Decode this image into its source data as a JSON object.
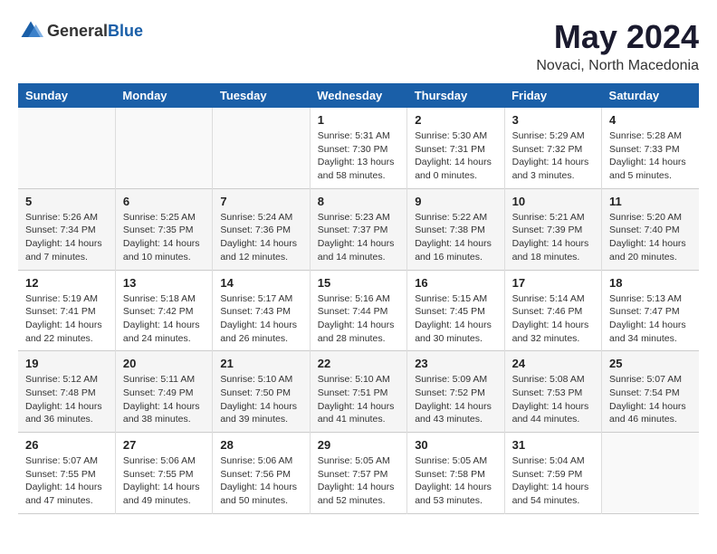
{
  "header": {
    "logo_general": "General",
    "logo_blue": "Blue",
    "title": "May 2024",
    "subtitle": "Novaci, North Macedonia"
  },
  "weekdays": [
    "Sunday",
    "Monday",
    "Tuesday",
    "Wednesday",
    "Thursday",
    "Friday",
    "Saturday"
  ],
  "weeks": [
    [
      {
        "day": "",
        "sunrise": "",
        "sunset": "",
        "daylight": "",
        "empty": true
      },
      {
        "day": "",
        "sunrise": "",
        "sunset": "",
        "daylight": "",
        "empty": true
      },
      {
        "day": "",
        "sunrise": "",
        "sunset": "",
        "daylight": "",
        "empty": true
      },
      {
        "day": "1",
        "sunrise": "Sunrise: 5:31 AM",
        "sunset": "Sunset: 7:30 PM",
        "daylight": "Daylight: 13 hours and 58 minutes.",
        "empty": false
      },
      {
        "day": "2",
        "sunrise": "Sunrise: 5:30 AM",
        "sunset": "Sunset: 7:31 PM",
        "daylight": "Daylight: 14 hours and 0 minutes.",
        "empty": false
      },
      {
        "day": "3",
        "sunrise": "Sunrise: 5:29 AM",
        "sunset": "Sunset: 7:32 PM",
        "daylight": "Daylight: 14 hours and 3 minutes.",
        "empty": false
      },
      {
        "day": "4",
        "sunrise": "Sunrise: 5:28 AM",
        "sunset": "Sunset: 7:33 PM",
        "daylight": "Daylight: 14 hours and 5 minutes.",
        "empty": false
      }
    ],
    [
      {
        "day": "5",
        "sunrise": "Sunrise: 5:26 AM",
        "sunset": "Sunset: 7:34 PM",
        "daylight": "Daylight: 14 hours and 7 minutes.",
        "empty": false
      },
      {
        "day": "6",
        "sunrise": "Sunrise: 5:25 AM",
        "sunset": "Sunset: 7:35 PM",
        "daylight": "Daylight: 14 hours and 10 minutes.",
        "empty": false
      },
      {
        "day": "7",
        "sunrise": "Sunrise: 5:24 AM",
        "sunset": "Sunset: 7:36 PM",
        "daylight": "Daylight: 14 hours and 12 minutes.",
        "empty": false
      },
      {
        "day": "8",
        "sunrise": "Sunrise: 5:23 AM",
        "sunset": "Sunset: 7:37 PM",
        "daylight": "Daylight: 14 hours and 14 minutes.",
        "empty": false
      },
      {
        "day": "9",
        "sunrise": "Sunrise: 5:22 AM",
        "sunset": "Sunset: 7:38 PM",
        "daylight": "Daylight: 14 hours and 16 minutes.",
        "empty": false
      },
      {
        "day": "10",
        "sunrise": "Sunrise: 5:21 AM",
        "sunset": "Sunset: 7:39 PM",
        "daylight": "Daylight: 14 hours and 18 minutes.",
        "empty": false
      },
      {
        "day": "11",
        "sunrise": "Sunrise: 5:20 AM",
        "sunset": "Sunset: 7:40 PM",
        "daylight": "Daylight: 14 hours and 20 minutes.",
        "empty": false
      }
    ],
    [
      {
        "day": "12",
        "sunrise": "Sunrise: 5:19 AM",
        "sunset": "Sunset: 7:41 PM",
        "daylight": "Daylight: 14 hours and 22 minutes.",
        "empty": false
      },
      {
        "day": "13",
        "sunrise": "Sunrise: 5:18 AM",
        "sunset": "Sunset: 7:42 PM",
        "daylight": "Daylight: 14 hours and 24 minutes.",
        "empty": false
      },
      {
        "day": "14",
        "sunrise": "Sunrise: 5:17 AM",
        "sunset": "Sunset: 7:43 PM",
        "daylight": "Daylight: 14 hours and 26 minutes.",
        "empty": false
      },
      {
        "day": "15",
        "sunrise": "Sunrise: 5:16 AM",
        "sunset": "Sunset: 7:44 PM",
        "daylight": "Daylight: 14 hours and 28 minutes.",
        "empty": false
      },
      {
        "day": "16",
        "sunrise": "Sunrise: 5:15 AM",
        "sunset": "Sunset: 7:45 PM",
        "daylight": "Daylight: 14 hours and 30 minutes.",
        "empty": false
      },
      {
        "day": "17",
        "sunrise": "Sunrise: 5:14 AM",
        "sunset": "Sunset: 7:46 PM",
        "daylight": "Daylight: 14 hours and 32 minutes.",
        "empty": false
      },
      {
        "day": "18",
        "sunrise": "Sunrise: 5:13 AM",
        "sunset": "Sunset: 7:47 PM",
        "daylight": "Daylight: 14 hours and 34 minutes.",
        "empty": false
      }
    ],
    [
      {
        "day": "19",
        "sunrise": "Sunrise: 5:12 AM",
        "sunset": "Sunset: 7:48 PM",
        "daylight": "Daylight: 14 hours and 36 minutes.",
        "empty": false
      },
      {
        "day": "20",
        "sunrise": "Sunrise: 5:11 AM",
        "sunset": "Sunset: 7:49 PM",
        "daylight": "Daylight: 14 hours and 38 minutes.",
        "empty": false
      },
      {
        "day": "21",
        "sunrise": "Sunrise: 5:10 AM",
        "sunset": "Sunset: 7:50 PM",
        "daylight": "Daylight: 14 hours and 39 minutes.",
        "empty": false
      },
      {
        "day": "22",
        "sunrise": "Sunrise: 5:10 AM",
        "sunset": "Sunset: 7:51 PM",
        "daylight": "Daylight: 14 hours and 41 minutes.",
        "empty": false
      },
      {
        "day": "23",
        "sunrise": "Sunrise: 5:09 AM",
        "sunset": "Sunset: 7:52 PM",
        "daylight": "Daylight: 14 hours and 43 minutes.",
        "empty": false
      },
      {
        "day": "24",
        "sunrise": "Sunrise: 5:08 AM",
        "sunset": "Sunset: 7:53 PM",
        "daylight": "Daylight: 14 hours and 44 minutes.",
        "empty": false
      },
      {
        "day": "25",
        "sunrise": "Sunrise: 5:07 AM",
        "sunset": "Sunset: 7:54 PM",
        "daylight": "Daylight: 14 hours and 46 minutes.",
        "empty": false
      }
    ],
    [
      {
        "day": "26",
        "sunrise": "Sunrise: 5:07 AM",
        "sunset": "Sunset: 7:55 PM",
        "daylight": "Daylight: 14 hours and 47 minutes.",
        "empty": false
      },
      {
        "day": "27",
        "sunrise": "Sunrise: 5:06 AM",
        "sunset": "Sunset: 7:55 PM",
        "daylight": "Daylight: 14 hours and 49 minutes.",
        "empty": false
      },
      {
        "day": "28",
        "sunrise": "Sunrise: 5:06 AM",
        "sunset": "Sunset: 7:56 PM",
        "daylight": "Daylight: 14 hours and 50 minutes.",
        "empty": false
      },
      {
        "day": "29",
        "sunrise": "Sunrise: 5:05 AM",
        "sunset": "Sunset: 7:57 PM",
        "daylight": "Daylight: 14 hours and 52 minutes.",
        "empty": false
      },
      {
        "day": "30",
        "sunrise": "Sunrise: 5:05 AM",
        "sunset": "Sunset: 7:58 PM",
        "daylight": "Daylight: 14 hours and 53 minutes.",
        "empty": false
      },
      {
        "day": "31",
        "sunrise": "Sunrise: 5:04 AM",
        "sunset": "Sunset: 7:59 PM",
        "daylight": "Daylight: 14 hours and 54 minutes.",
        "empty": false
      },
      {
        "day": "",
        "sunrise": "",
        "sunset": "",
        "daylight": "",
        "empty": true
      }
    ]
  ]
}
